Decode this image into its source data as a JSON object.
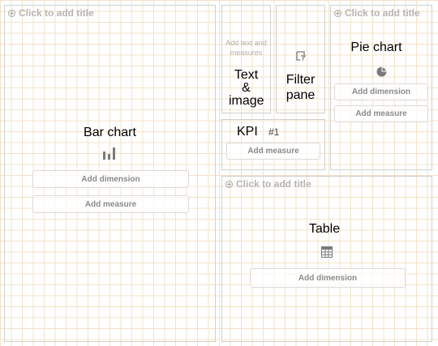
{
  "bar_chart_panel": {
    "title_placeholder": "Click to add title",
    "chart_name": "Bar chart",
    "dimension_button": "Add dimension",
    "measure_button": "Add measure"
  },
  "text_image_panel": {
    "placeholder": "Add text and measures",
    "chart_name": "Text & image"
  },
  "filter_pane_panel": {
    "chart_name": "Filter pane"
  },
  "pie_chart_panel": {
    "title_placeholder": "Click to add title",
    "chart_name": "Pie chart",
    "dimension_button": "Add dimension",
    "measure_button": "Add measure"
  },
  "kpi_panel": {
    "chart_name": "KPI",
    "icon_glyph": "#1",
    "measure_button": "Add measure"
  },
  "table_panel": {
    "title_placeholder": "Click to add title",
    "chart_name": "Table",
    "dimension_button": "Add dimension"
  }
}
